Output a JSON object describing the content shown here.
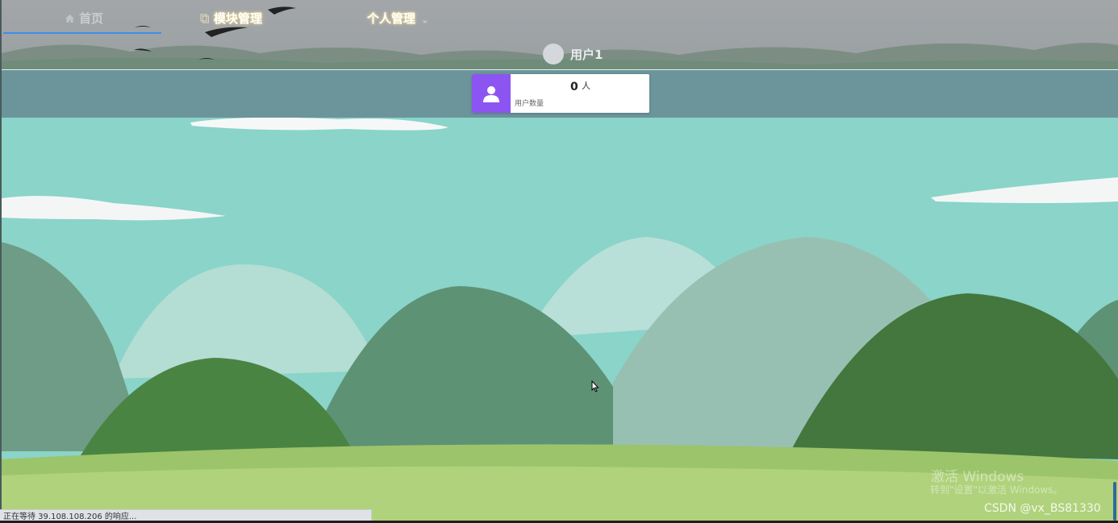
{
  "nav": {
    "items": [
      {
        "label": "首页",
        "icon": "home-icon",
        "active": true
      },
      {
        "label": "模块管理",
        "icon": "module-icon"
      },
      {
        "label": "个人管理",
        "icon": "chevron-down-icon"
      }
    ],
    "user": {
      "name": "用户1",
      "avatar": "avatar"
    }
  },
  "stats": {
    "user_count": {
      "value": "0",
      "unit": "人",
      "label": "用户数量",
      "icon": "user-icon",
      "accent": "#8c55f2"
    }
  },
  "status_bar": {
    "text": "正在等待 39.108.108.206 的响应..."
  },
  "watermark": {
    "line1": "激活 Windows",
    "line2": "转到\"设置\"以激活 Windows。"
  },
  "credit": "CSDN @vx_BS81330",
  "colors": {
    "band": "#6b959b",
    "sky": "#8ad4c9",
    "nav_active_underline": "#3d8ee8"
  }
}
